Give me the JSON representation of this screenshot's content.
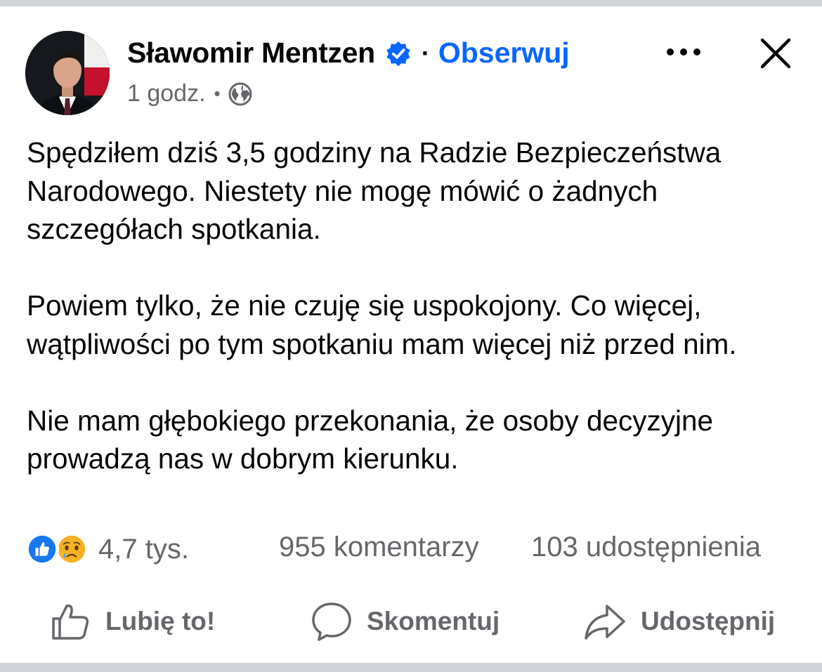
{
  "post": {
    "author": "Sławomir Mentzen",
    "follow_label": "Obserwuj",
    "separator_dot": "·",
    "time": "1 godz.",
    "meta_dot": "•",
    "paragraphs": [
      "Spędziłem dziś 3,5 godziny na Radzie Bezpieczeństwa Narodowego. Niestety nie mogę mówić o żadnych szczegółach spotkania.",
      "Powiem tylko, że nie czuję się uspokojony. Co więcej, wątpliwości po tym spotkaniu mam więcej niż przed nim.",
      "Nie mam głębokiego przekonania, że osoby decyzyjne prowadzą nas w dobrym kierunku."
    ]
  },
  "stats": {
    "reactions_count": "4,7 tys.",
    "comments": "955 komentarzy",
    "shares": "103 udostępnienia"
  },
  "actions": {
    "like": "Lubię to!",
    "comment": "Skomentuj",
    "share": "Udostępnij"
  },
  "icons": {
    "verified": "verified-badge-icon",
    "globe": "globe-icon",
    "more": "more-options-icon",
    "close": "close-icon",
    "like_reaction": "like-reaction-icon",
    "sad_reaction": "sad-reaction-icon",
    "like_action": "thumbs-up-icon",
    "comment_action": "speech-bubble-icon",
    "share_action": "share-arrow-icon"
  },
  "colors": {
    "accent": "#0866ff",
    "text": "#050505",
    "secondary_text": "#65676b",
    "divider": "#cfd2d6",
    "sad_emoji": "#f7b125"
  }
}
